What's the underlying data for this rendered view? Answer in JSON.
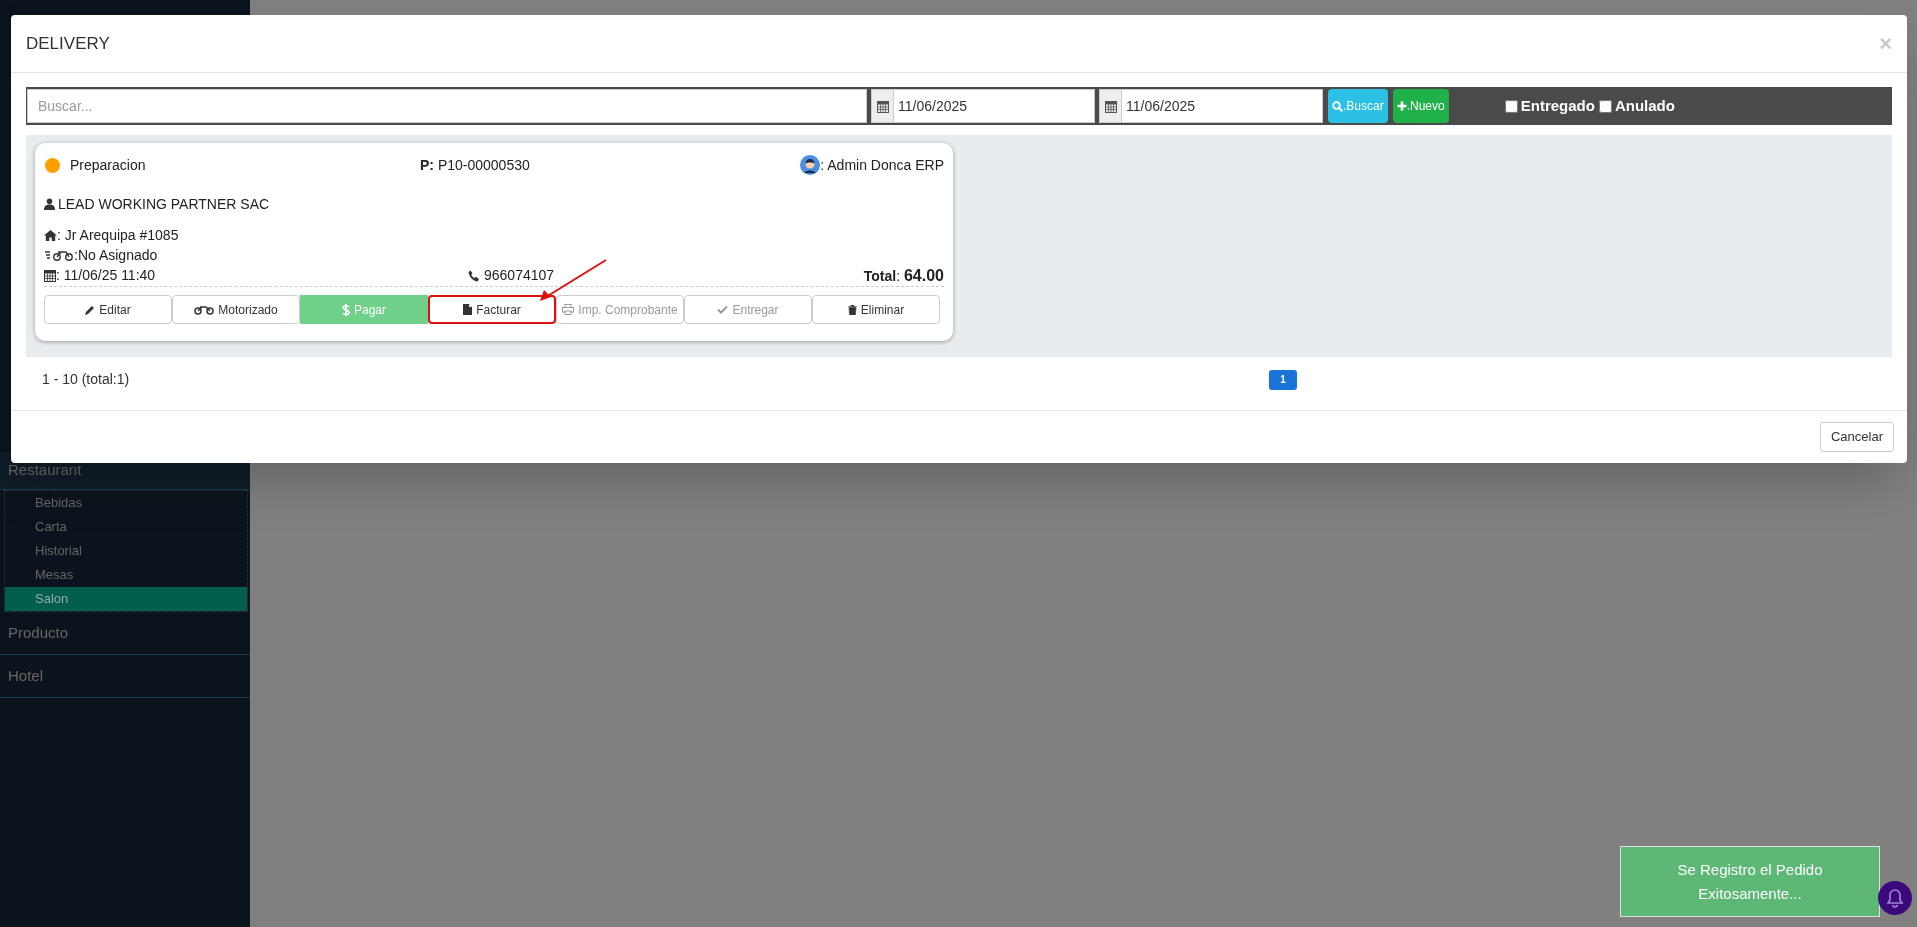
{
  "sidebar": {
    "section": "Restaurant",
    "items": [
      {
        "label": "Bebidas",
        "selected": false
      },
      {
        "label": "Carta",
        "selected": false
      },
      {
        "label": "Historial",
        "selected": false
      },
      {
        "label": "Mesas",
        "selected": false
      },
      {
        "label": "Salon",
        "selected": true
      }
    ],
    "groups": [
      "Producto",
      "Hotel"
    ]
  },
  "modal": {
    "title": "DELIVERY",
    "close": "×",
    "search": {
      "placeholder": "Buscar..."
    },
    "dates": [
      "11/06/2025",
      "11/06/2025"
    ],
    "buttons": [
      {
        "label": ".Buscar",
        "kind": "info"
      },
      {
        "label": ".Nuevo",
        "kind": "success"
      }
    ],
    "filters": [
      {
        "label": "Entregado",
        "checked": false
      },
      {
        "label": "Anulado",
        "checked": false
      }
    ],
    "orders": [
      {
        "status": "Preparacion",
        "color": "#ff9f00",
        "code": "**P:** P10-00000530",
        "user": ": Admin Donca ERP",
        "client": "LEAD WORKING PARTNER SAC",
        "address": ": Jr Arequipa #1085",
        "driver": ":No Asignado",
        "datetime": ": 11/06/25 11:40",
        "phone": "966074107",
        "total": "**Total**: **64.00**",
        "actions": [
          {
            "label": "Editar",
            "kind": "default",
            "disabled": false,
            "highlighted": false
          },
          {
            "label": "Motorizado",
            "kind": "default",
            "disabled": false,
            "highlighted": false
          },
          {
            "label": "Pagar",
            "kind": "success",
            "disabled": false,
            "highlighted": false
          },
          {
            "label": "Facturar",
            "kind": "default",
            "disabled": false,
            "highlighted": true
          },
          {
            "label": "Imp. Comprobante",
            "kind": "default",
            "disabled": true,
            "highlighted": false
          },
          {
            "label": "Entregar",
            "kind": "default",
            "disabled": true,
            "highlighted": false
          },
          {
            "label": "Eliminar",
            "kind": "default",
            "disabled": false,
            "highlighted": false
          }
        ]
      }
    ],
    "pagination": {
      "range": "1 - 10 (total:1)",
      "pages": [
        {
          "label": "1",
          "selected": true
        }
      ]
    },
    "footer_button": "Cancelar"
  },
  "toast": {
    "message": "Se Registro el Pedido Exitosamente..."
  }
}
